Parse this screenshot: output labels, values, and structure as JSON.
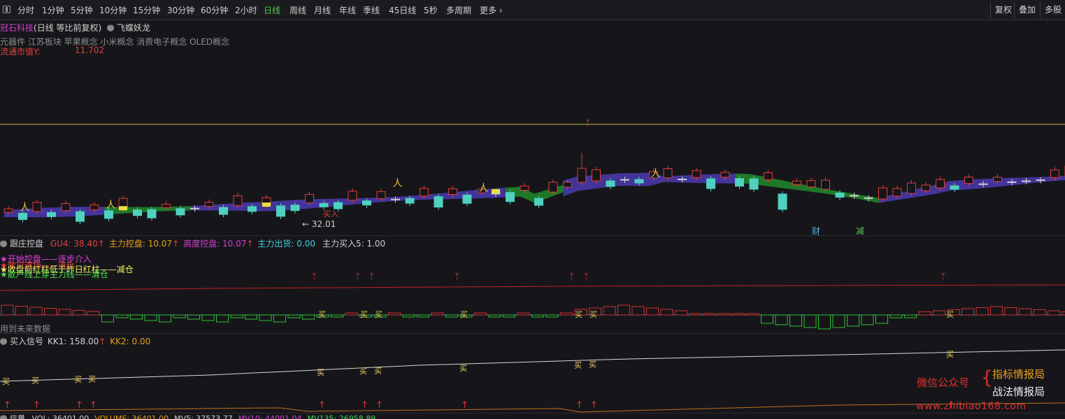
{
  "toolbar": {
    "periods": [
      "分时",
      "1分钟",
      "5分钟",
      "10分钟",
      "15分钟",
      "30分钟",
      "60分钟",
      "2小时",
      "日线",
      "周线",
      "月线",
      "年线",
      "季线",
      "45日线",
      "5秒",
      "多周期",
      "更多"
    ],
    "active_period": "日线",
    "right_buttons": [
      "复权",
      "叠加",
      "多股"
    ]
  },
  "header": {
    "stock_name": "冠石科技",
    "mode": "(日线 等比前复权)",
    "indicator_name": "飞蝶妖龙",
    "concepts": "元器件 江苏板块 苹果概念 小米概念 消费电子概念 OLED概念",
    "float_cap_label": "流通市值Y:",
    "float_cap_value": "11.702"
  },
  "main_chart": {
    "low_price_label": "32.01",
    "buy_label": "买入",
    "tag_cai": "财",
    "tag_jian": "减"
  },
  "panel2": {
    "title": "跟庄控盘",
    "items": [
      {
        "label": "GU4: 38.40",
        "color": "#e04040"
      },
      {
        "label": "主力控盘: 10.07",
        "color": "#e8a020"
      },
      {
        "label": "高度控盘: 10.07",
        "color": "#d040d0"
      },
      {
        "label": "主力出货: 0.00",
        "color": "#40d0e0"
      },
      {
        "label": "主力买入5: 1.00",
        "color": "#d0d0d0"
      }
    ],
    "legend_lines": [
      {
        "text": "★开始控盘——逐步介入",
        "color": "#e040e0"
      },
      {
        "text": "★散户进场——清仓",
        "color": "#e04040"
      },
      {
        "text": "★收盘前红柱低于昨日红柱——减仓",
        "color": "#f0f060"
      },
      {
        "text": "★散户线上穿主力线——清仓",
        "color": "#50e050"
      }
    ],
    "footer": "用到未来数据"
  },
  "panel3": {
    "title": "买入信号",
    "kk1": "KK1: 158.00",
    "kk2": "KK2: 0.00",
    "buy_char": "买"
  },
  "bottom_bar": {
    "title": "信量",
    "items": [
      {
        "label": "VOL: 36401.00",
        "color": "#d0d0d0"
      },
      {
        "label": "VOLUME: 36401.00",
        "color": "#e8a020"
      },
      {
        "label": "MV5: 37573.77",
        "color": "#d0d0d0"
      },
      {
        "label": "MV10: 44001.04",
        "color": "#d040d0"
      },
      {
        "label": "MV135: 26958.89",
        "color": "#40d060"
      }
    ]
  },
  "watermark": {
    "line1_left": "微信公众号",
    "line1_right": "指标情报局",
    "line2_right": "战法情报局",
    "url": "www.zhibiao168.com"
  },
  "colors": {
    "up": "#e23b3b",
    "down": "#4fd0c0",
    "band_up": "#4a3ab0",
    "band_down": "#1f8a2a",
    "active": "#4ec94e"
  }
}
